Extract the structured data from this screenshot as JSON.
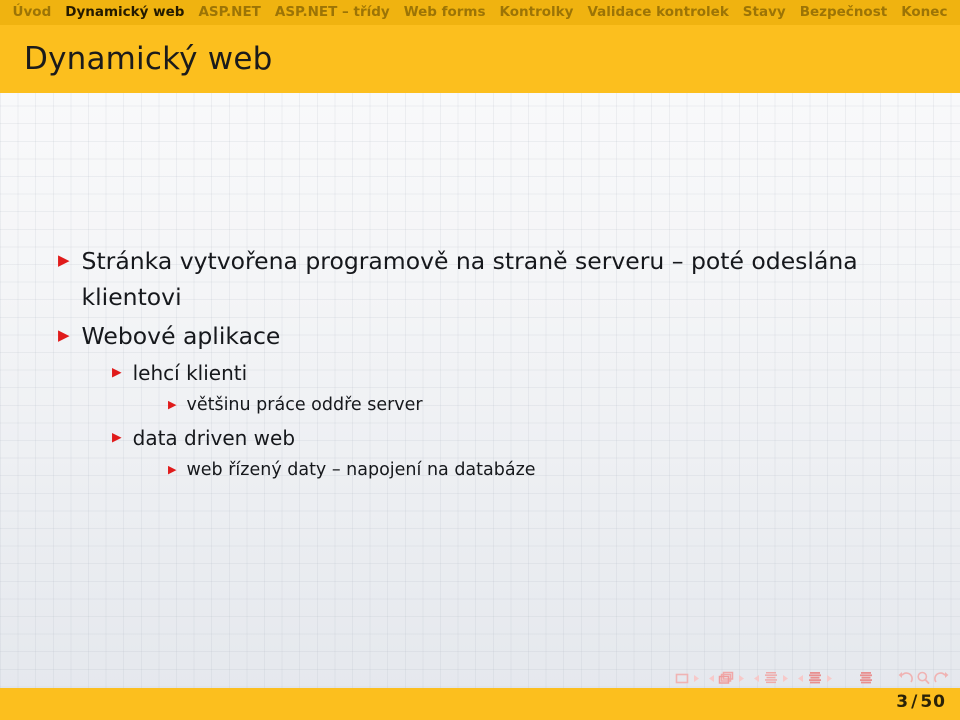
{
  "navbar": {
    "items": [
      {
        "label": "Úvod",
        "active": false
      },
      {
        "label": "Dynamický web",
        "active": true
      },
      {
        "label": "ASP.NET",
        "active": false
      },
      {
        "label": "ASP.NET – třídy",
        "active": false
      },
      {
        "label": "Web forms",
        "active": false
      },
      {
        "label": "Kontrolky",
        "active": false
      },
      {
        "label": "Validace kontrolek",
        "active": false
      },
      {
        "label": "Stavy",
        "active": false
      },
      {
        "label": "Bezpečnost",
        "active": false
      },
      {
        "label": "Konec",
        "active": false
      }
    ],
    "bar_color": "#f0b310",
    "active_color": "#241a00",
    "inactive_color": "#9c7406"
  },
  "title": {
    "text": "Dynamický web",
    "band_color": "#fcbf1e"
  },
  "content": {
    "bullet_color": "#e01b1b",
    "items": [
      {
        "level": 1,
        "text": "Stránka vytvořena programově na straně serveru – poté odeslána klientovi"
      },
      {
        "level": 1,
        "text": "Webové aplikace"
      },
      {
        "level": 2,
        "text": "lehcí klienti"
      },
      {
        "level": 3,
        "text": "většinu práce oddře server"
      },
      {
        "level": 2,
        "text": "data driven web"
      },
      {
        "level": 3,
        "text": "web řízený daty – napojení na databáze"
      }
    ]
  },
  "footer": {
    "bar_color": "#fcbf1e",
    "page_current": "3",
    "page_separator": "/",
    "page_total": "50",
    "nav_symbols": [
      "slide-icon",
      "slide-next-icon",
      "frame-prev-icon",
      "frame-icon",
      "frame-next-icon",
      "subsection-prev-icon",
      "subsection-icon",
      "subsection-next-icon",
      "section-prev-icon",
      "section-icon",
      "section-next-icon",
      "doc-icon",
      "back-icon",
      "search-icon",
      "forward-icon"
    ]
  }
}
